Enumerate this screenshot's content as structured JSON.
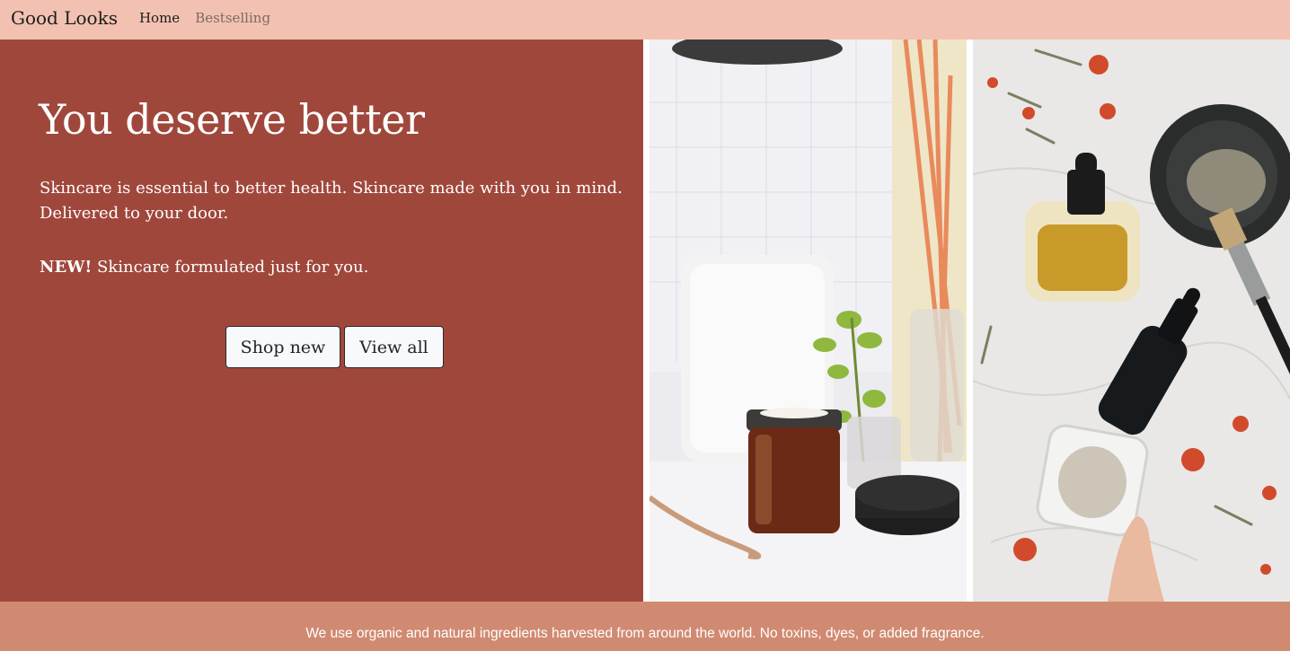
{
  "navbar": {
    "brand": "Good Looks",
    "links": [
      {
        "label": "Home",
        "active": true
      },
      {
        "label": "Bestselling",
        "active": false
      }
    ]
  },
  "hero": {
    "title": "You deserve better",
    "lead": "Skincare is essential to better health. Skincare made with you in mind. Delivered to your door.",
    "new_badge": "NEW!",
    "new_text": " Skincare formulated just for you.",
    "buttons": {
      "shop_new": "Shop new",
      "view_all": "View all"
    }
  },
  "images": [
    {
      "subject": "amber skincare jar with plant and candle"
    },
    {
      "subject": "serum dropper bottles, clay powder and flowers on marble"
    }
  ],
  "footer": {
    "text": "We use organic and natural ingredients harvested from around the world. No toxins, dyes, or added fragrance."
  },
  "colors": {
    "navbar_bg": "#f2c1b1",
    "hero_bg": "#a0473c",
    "footer_bg": "#d08a71",
    "button_bg": "#f8f9fa"
  }
}
